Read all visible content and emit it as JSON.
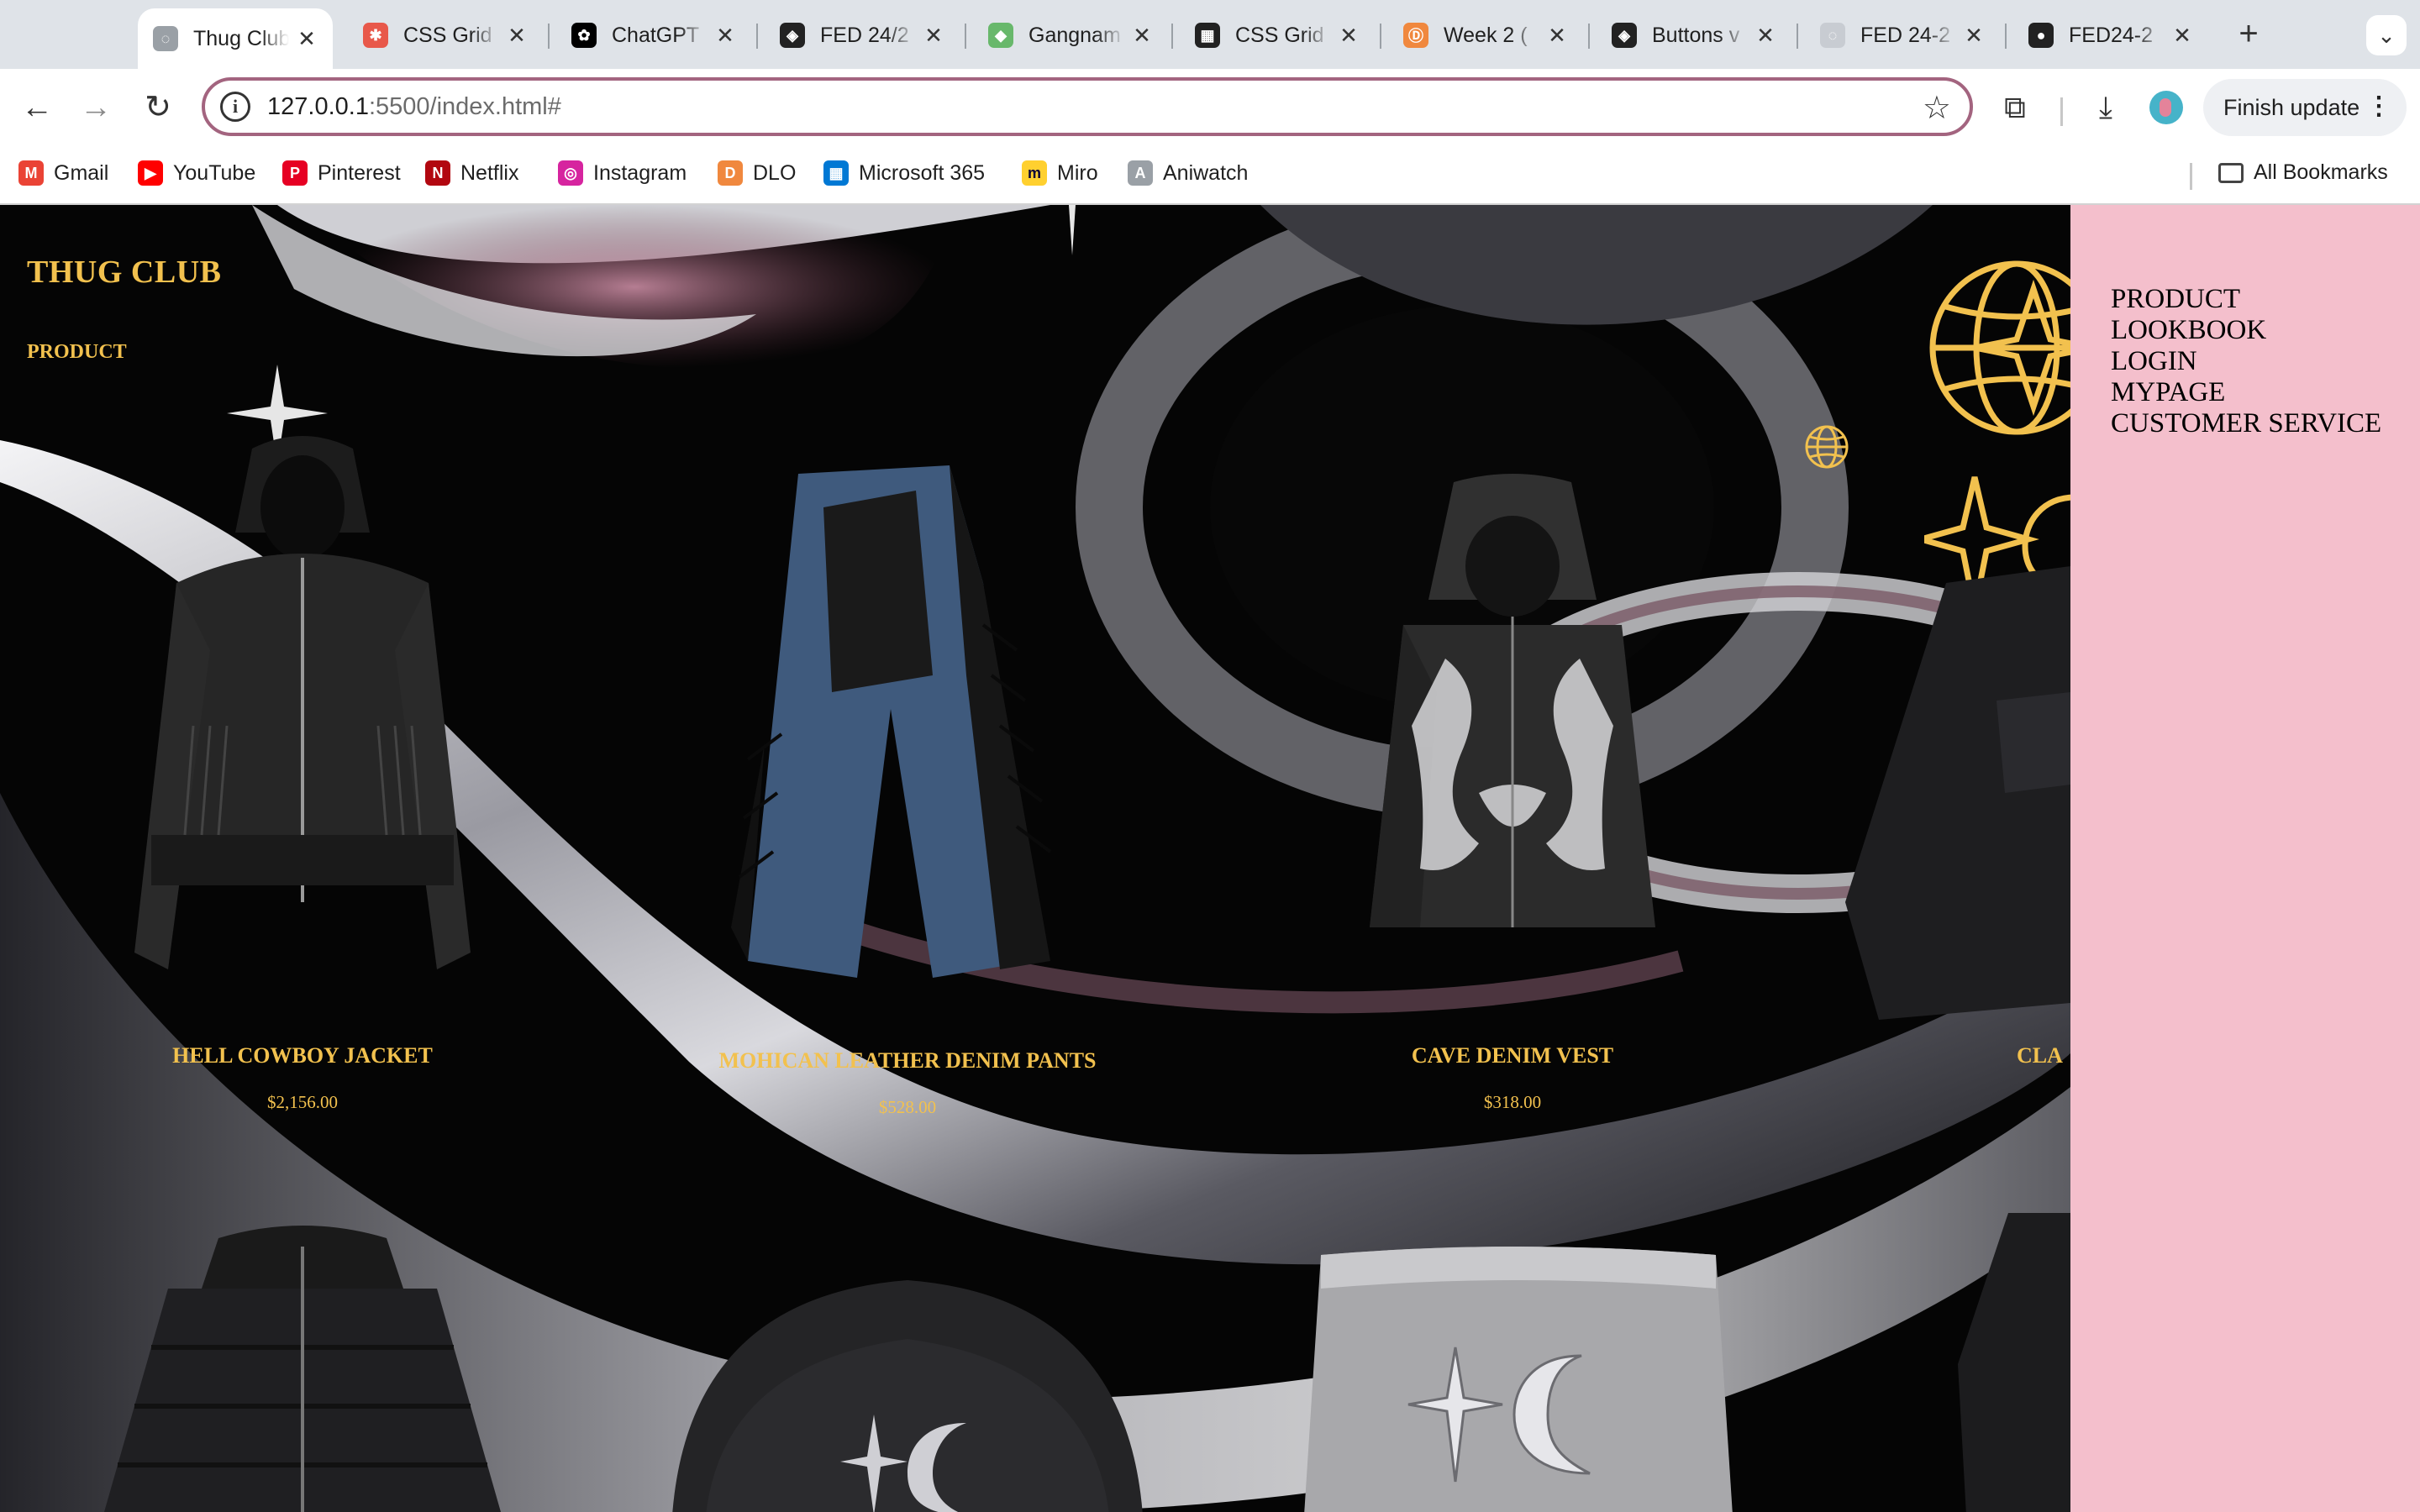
{
  "browser": {
    "tabs": [
      {
        "title": "Thug Club",
        "icon": "globe-icon",
        "color": "#9aa0a6",
        "active": true
      },
      {
        "title": "CSS Grid",
        "icon": "asterisk-icon",
        "color": "#e8584a",
        "active": false
      },
      {
        "title": "ChatGPT",
        "icon": "chatgpt-icon",
        "color": "#000000",
        "active": false
      },
      {
        "title": "FED 24/2",
        "icon": "codepen-icon",
        "color": "#222222",
        "active": false
      },
      {
        "title": "Gangnam",
        "icon": "map-icon",
        "color": "#68b86b",
        "active": false
      },
      {
        "title": "CSS Grid",
        "icon": "grid-icon",
        "color": "#222222",
        "active": false
      },
      {
        "title": "Week 2 (",
        "icon": "course-icon",
        "color": "#f0883e",
        "active": false
      },
      {
        "title": "Buttons v",
        "icon": "codepen-icon",
        "color": "#222222",
        "active": false
      },
      {
        "title": "FED 24-2",
        "icon": "globe-icon",
        "color": "#c8ccd2",
        "active": false
      },
      {
        "title": "FED24-2",
        "icon": "github-icon",
        "color": "#222222",
        "active": false
      }
    ],
    "close_glyph": "✕",
    "new_tab_glyph": "+",
    "tab_search_glyph": "⌄",
    "address": {
      "host": "127.0.0.1",
      "rest": ":5500/index.html#"
    },
    "finish_update_label": "Finish update",
    "bookmarks": [
      {
        "label": "Gmail",
        "icon": "gmail-icon",
        "color": "#ea4335"
      },
      {
        "label": "YouTube",
        "icon": "youtube-icon",
        "color": "#ff0000"
      },
      {
        "label": "Pinterest",
        "icon": "pinterest-icon",
        "color": "#e60023"
      },
      {
        "label": "Netflix",
        "icon": "netflix-icon",
        "color": "#b20710"
      },
      {
        "label": "Instagram",
        "icon": "instagram-icon",
        "color": "#d6249f"
      },
      {
        "label": "DLO",
        "icon": "dlo-icon",
        "color": "#f0883e"
      },
      {
        "label": "Microsoft 365",
        "icon": "microsoft-icon",
        "color": "#0078d4"
      },
      {
        "label": "Miro",
        "icon": "miro-icon",
        "color": "#ffd02f"
      },
      {
        "label": "Aniwatch",
        "icon": "aniwatch-icon",
        "color": "#9aa0a6"
      }
    ],
    "all_bookmarks_label": "All Bookmarks"
  },
  "page": {
    "brand": "THUG CLUB",
    "subnav": "PRODUCT",
    "accent_color": "#f2c14e",
    "products": [
      {
        "name": "HELL COWBOY JACKET",
        "price": "$2,156.00"
      },
      {
        "name": "MOHICAN LEATHER DENIM PANTS",
        "price": "$528.00"
      },
      {
        "name": "CAVE DENIM VEST",
        "price": "$318.00"
      },
      {
        "name": "CLA",
        "price": ""
      }
    ],
    "menu": [
      "PRODUCT",
      "LOOKBOOK",
      "LOGIN",
      "MYPAGE",
      "CUSTOMER SERVICE"
    ],
    "menu_bg": "#f4bfcc"
  }
}
